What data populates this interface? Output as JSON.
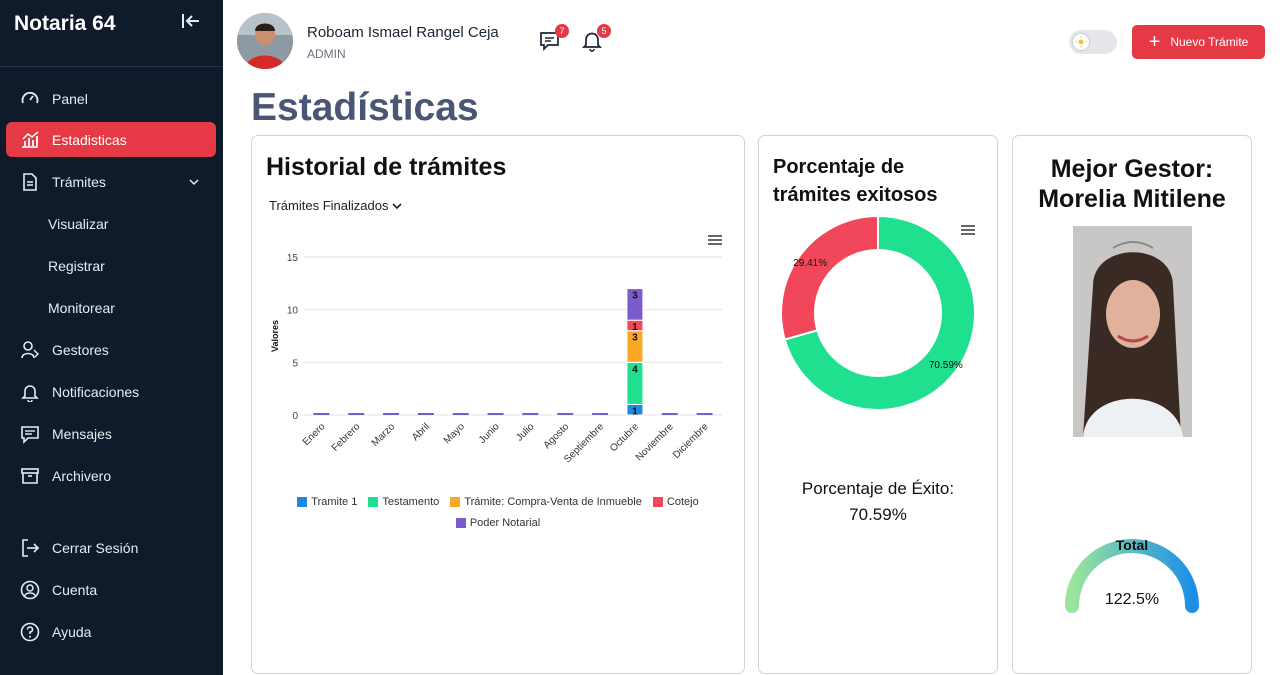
{
  "sidebar": {
    "brand": "Notaria 64",
    "items": [
      {
        "label": "Panel",
        "icon": "gauge-icon"
      },
      {
        "label": "Estadisticas",
        "icon": "chart-icon"
      },
      {
        "label": "Trámites",
        "icon": "document-icon"
      },
      {
        "label": "Visualizar"
      },
      {
        "label": "Registrar"
      },
      {
        "label": "Monitorear"
      },
      {
        "label": "Gestores",
        "icon": "users-icon"
      },
      {
        "label": "Notificaciones",
        "icon": "bell-icon"
      },
      {
        "label": "Mensajes",
        "icon": "message-icon"
      },
      {
        "label": "Archivero",
        "icon": "archive-icon"
      }
    ],
    "bottom_items": [
      {
        "label": "Cerrar Sesión",
        "icon": "logout-icon"
      },
      {
        "label": "Cuenta",
        "icon": "account-icon"
      },
      {
        "label": "Ayuda",
        "icon": "help-icon"
      }
    ],
    "active_color": "#e63946",
    "background": "#0f1a2b"
  },
  "topbar": {
    "user_name": "Roboam Ismael Rangel Ceja",
    "user_role": "ADMIN",
    "messages_badge": "7",
    "notifications_badge": "5",
    "new_button_label": "Nuevo Trámite"
  },
  "page": {
    "title": "Estadísticas"
  },
  "history_card": {
    "title": "Historial de trámites",
    "filter_label": "Trámites Finalizados",
    "legend": [
      {
        "name": "Tramite 1",
        "color": "#1e88e5"
      },
      {
        "name": "Testamento",
        "color": "#1ee08e"
      },
      {
        "name": "Trámite: Compra-Venta de Inmueble",
        "color": "#f9a825"
      },
      {
        "name": "Cotejo",
        "color": "#f2475a"
      },
      {
        "name": "Poder Notarial",
        "color": "#7b5ccf"
      }
    ]
  },
  "success_card": {
    "title_line1": "Porcentaje de",
    "title_line2": "trámites exitosos",
    "result_label": "Porcentaje de Éxito:",
    "result_value": "70.59%"
  },
  "manager_card": {
    "title_line1": "Mejor Gestor:",
    "title_line2": "Morelia Mitilene",
    "gauge_label": "Total",
    "gauge_value": "122.5%",
    "gauge_fraction": 1.0
  },
  "chart_data": [
    {
      "type": "bar",
      "stacked": true,
      "ylabel": "Valores",
      "ylim": [
        0,
        15
      ],
      "yticks": [
        0,
        5,
        10,
        15
      ],
      "categories": [
        "Enero",
        "Febrero",
        "Marzo",
        "Abril",
        "Mayo",
        "Junio",
        "Julio",
        "Agosto",
        "Septiembre",
        "Octubre",
        "Noviembre",
        "Diciembre"
      ],
      "series": [
        {
          "name": "Tramite 1",
          "color": "#1e88e5",
          "values": [
            0,
            0,
            0,
            0,
            0,
            0,
            0,
            0,
            0,
            1,
            0,
            0
          ]
        },
        {
          "name": "Testamento",
          "color": "#1ee08e",
          "values": [
            0,
            0,
            0,
            0,
            0,
            0,
            0,
            0,
            0,
            4,
            0,
            0
          ]
        },
        {
          "name": "Trámite: Compra-Venta de Inmueble",
          "color": "#f9a825",
          "values": [
            0,
            0,
            0,
            0,
            0,
            0,
            0,
            0,
            0,
            3,
            0,
            0
          ]
        },
        {
          "name": "Cotejo",
          "color": "#f2475a",
          "values": [
            0,
            0,
            0,
            0,
            0,
            0,
            0,
            0,
            0,
            1,
            0,
            0
          ]
        },
        {
          "name": "Poder Notarial",
          "color": "#7b5ccf",
          "values": [
            0,
            0,
            0,
            0,
            0,
            0,
            0,
            0,
            0,
            3,
            0,
            0
          ]
        }
      ]
    },
    {
      "type": "pie",
      "donut": true,
      "slices": [
        {
          "label": "70.59%",
          "value": 70.59,
          "color": "#1ee08e"
        },
        {
          "label": "29.41%",
          "value": 29.41,
          "color": "#f2475a"
        }
      ]
    }
  ]
}
